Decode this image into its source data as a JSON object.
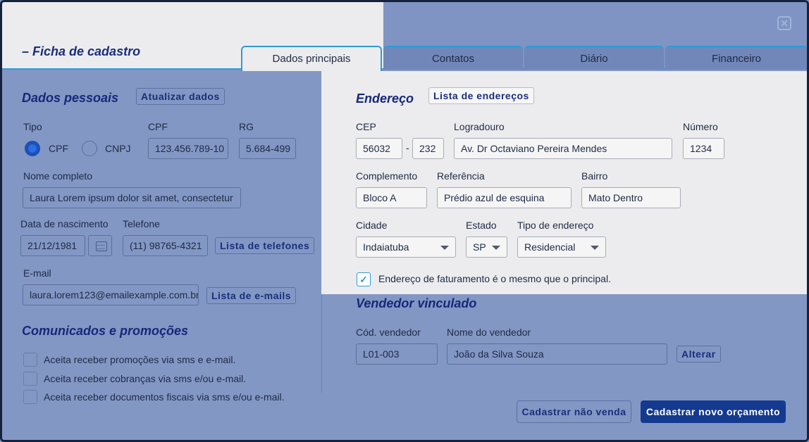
{
  "header": {
    "title": "Ficha de cadastro",
    "close_icon": "close-icon",
    "tabs": [
      {
        "label": "Dados principais",
        "active": true
      },
      {
        "label": "Contatos",
        "active": false
      },
      {
        "label": "Diário",
        "active": false
      },
      {
        "label": "Financeiro",
        "active": false
      }
    ]
  },
  "dados_pessoais": {
    "heading": "Dados pessoais",
    "update_button": "Atualizar dados",
    "tipo_label": "Tipo",
    "tipo_options": [
      "CPF",
      "CNPJ"
    ],
    "tipo_selected": "CPF",
    "cpf_label": "CPF",
    "cpf_value": "123.456.789-10",
    "rg_label": "RG",
    "rg_value": "5.684-499",
    "nome_label": "Nome completo",
    "nome_value": "Laura Lorem ipsum dolor sit amet, consectetur",
    "nascimento_label": "Data de nascimento",
    "nascimento_value": "21/12/1981",
    "telefone_label": "Telefone",
    "telefone_value": "(11) 98765-4321",
    "telefones_button": "Lista de telefones",
    "email_label": "E-mail",
    "email_value": "laura.lorem123@emailexample.com.br",
    "emails_button": "Lista de e-mails"
  },
  "comunicados": {
    "heading": "Comunicados e promoções",
    "options": [
      "Aceita receber promoções via sms e e-mail.",
      "Aceita receber cobranças via sms e/ou e-mail.",
      "Aceita receber documentos fiscais via sms e/ou e-mail."
    ]
  },
  "endereco": {
    "heading": "Endereço",
    "list_button": "Lista de endereços",
    "cep_label": "CEP",
    "cep_part1": "56032",
    "cep_separator": "-",
    "cep_part2": "232",
    "logradouro_label": "Logradouro",
    "logradouro_value": "Av. Dr Octaviano Pereira Mendes",
    "numero_label": "Número",
    "numero_value": "1234",
    "complemento_label": "Complemento",
    "complemento_value": "Bloco A",
    "referencia_label": "Referência",
    "referencia_value": "Prédio azul de esquina",
    "bairro_label": "Bairro",
    "bairro_value": "Mato Dentro",
    "cidade_label": "Cidade",
    "cidade_value": "Indaiatuba",
    "estado_label": "Estado",
    "estado_value": "SP",
    "tipo_label": "Tipo de endereço",
    "tipo_value": "Residencial",
    "faturamento_label": "Endereço de faturamento é o mesmo que o principal.",
    "faturamento_checked": true
  },
  "vendedor": {
    "heading": "Vendedor vinculado",
    "codigo_label": "Cód. vendedor",
    "codigo_value": "L01-003",
    "nome_label": "Nome do vendedor",
    "nome_value": "João da Silva Souza",
    "alterar_button": "Alterar"
  },
  "footer": {
    "secondary_button": "Cadastrar não venda",
    "primary_button": "Cadastrar novo orçamento"
  }
}
